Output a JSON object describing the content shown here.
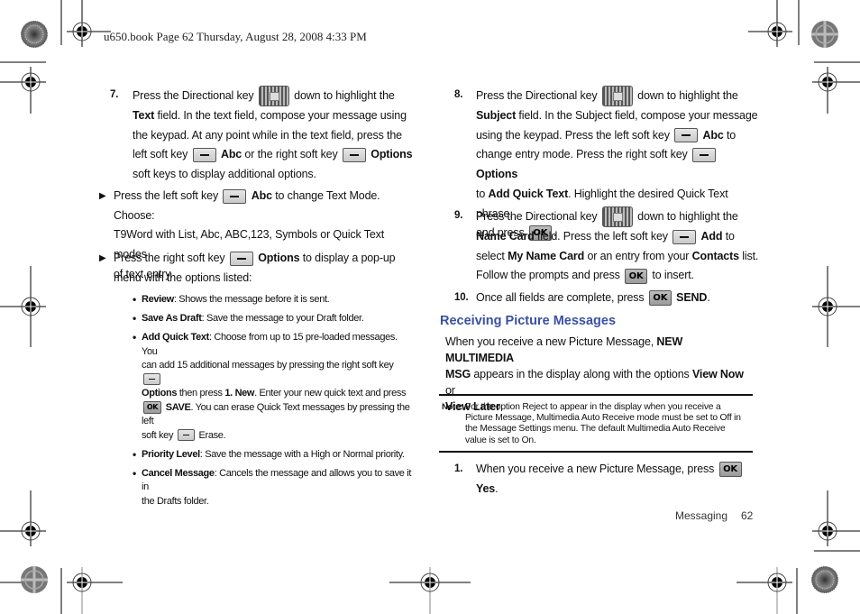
{
  "header": {
    "text": "u650.book  Page 62  Thursday, August 28, 2008  4:33 PM"
  },
  "left_column": {
    "step7": {
      "number": "7.",
      "line1_a": "Press the Directional key",
      "line1_b": "down to highlight the",
      "line2_bold": "Text",
      "line2_rest": " field. In the text field, compose your message using",
      "line3": "the keypad. At any point while in the text field, press the",
      "line4_a": "left soft key",
      "line4_b": "Abc",
      "line4_c": " or the right soft key",
      "line4_d": "Options",
      "line5": "soft keys to display additional options."
    },
    "arrow1": {
      "a": "Press the left soft key",
      "b": "Abc",
      "c": " to change Text Mode. Choose:",
      "line2": "T9Word with List, Abc, ABC,123, Symbols or Quick Text modes",
      "line3": "of text entry."
    },
    "arrow2": {
      "a": "Press the right soft key",
      "b": "Options",
      "c": " to display a pop-up",
      "line2": "menu with the options listed:"
    },
    "options": [
      {
        "term": "Review",
        "desc": ": Shows the message before it is sent."
      },
      {
        "term": "Save As Draft",
        "desc": ": Save the message to your Draft folder."
      },
      {
        "term": "Add Quick Text",
        "desc": ": Choose from up to 15 pre-loaded messages. You",
        "line2": "can add 15 additional messages by pressing the right soft key",
        "line3_bold": "Options",
        "line3_a": " then press ",
        "line3_bold2": "1. New",
        "line3_b": ". Enter your new quick text and press",
        "line4_bold": "SAVE",
        "line4_rest": ". You can erase Quick Text messages by pressing the left",
        "line5_a": "soft key",
        "line5_b": " Erase."
      },
      {
        "term": "Priority Level",
        "desc": ": Save the message with a High or Normal priority."
      },
      {
        "term": "Cancel Message",
        "desc": ": Cancels the message and allows you to save it in",
        "line2": "the Drafts folder."
      }
    ]
  },
  "right_column": {
    "step8": {
      "number": "8.",
      "line1_a": "Press the Directional key",
      "line1_b": "down to highlight the",
      "line2_bold": "Subject",
      "line2_rest": " field. In the Subject field, compose your message",
      "line3_a": "using the keypad. Press the left soft key",
      "line3_b": "Abc",
      "line3_c": " to",
      "line4_a": "change entry mode. Press the right soft key",
      "line4_b": "Options",
      "line5_a": "to ",
      "line5_b": "Add Quick Text",
      "line5_c": ". Highlight the desired Quick Text phrase,",
      "line6": "and press"
    },
    "step9": {
      "number": "9.",
      "line1_a": "Press the Directional key",
      "line1_b": "down to highlight the",
      "line2_bold": "Name Card",
      "line2_a": " field. Press the left soft key",
      "line2_b": "Add",
      "line2_c": " to",
      "line3_a": "select ",
      "line3_b": "My Name Card",
      "line3_c": " or an entry from your ",
      "line3_d": "Contacts",
      "line3_e": " list.",
      "line4_a": "Follow the prompts and press",
      "line4_b": " to insert."
    },
    "step10": {
      "number": "10.",
      "text": "Once all fields are complete, press",
      "bold": "SEND"
    },
    "section_heading": "Receiving Picture Messages",
    "intro": {
      "a": "When you receive a new Picture Message, ",
      "b": "NEW MULTIMEDIA",
      "c": "MSG",
      "d": " appears in the display along with the options ",
      "e": "View Now",
      "f": " or",
      "g": "View Later",
      "h": "."
    },
    "note": {
      "label": "Note:",
      "line1": "For the option Reject to appear in the display when you receive a",
      "line2": "Picture Message, Multimedia Auto Receive mode must be set to Off in",
      "line3": "the Message Settings menu. The default Multimedia Auto Receive",
      "line4": "value is set to On."
    },
    "step1": {
      "number": "1.",
      "text": "When you receive a new Picture Message, press",
      "bold": "Yes"
    }
  },
  "keys": {
    "ok_label": "OK"
  },
  "footer": {
    "section": "Messaging",
    "page": "62"
  },
  "colors": {
    "heading": "#3a50a5"
  }
}
